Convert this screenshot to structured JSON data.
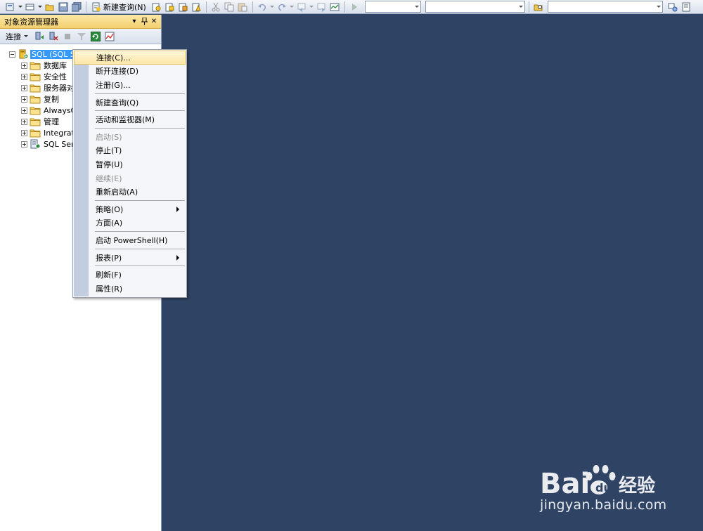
{
  "toolbar": {
    "new_query_label": "新建查询(N)"
  },
  "panel": {
    "title": "对象资源管理器",
    "pin_glyph": "▾",
    "autohide_glyph": "ᛰ",
    "close_glyph": "✕",
    "connect_label": "连接"
  },
  "tree": {
    "root": {
      "label": "SQL (SQL S",
      "icon": "server-icon"
    },
    "children": [
      {
        "label": "数据库",
        "icon": "folder-icon"
      },
      {
        "label": "安全性",
        "icon": "folder-icon"
      },
      {
        "label": "服务器对",
        "icon": "folder-icon"
      },
      {
        "label": "复制",
        "icon": "folder-icon"
      },
      {
        "label": "AlwaysO",
        "icon": "folder-icon"
      },
      {
        "label": "管理",
        "icon": "folder-icon"
      },
      {
        "label": "Integrat",
        "icon": "folder-icon"
      },
      {
        "label": "SQL Ser",
        "icon": "sql-agent-icon"
      }
    ]
  },
  "context_menu": {
    "items": [
      {
        "label": "连接(C)...",
        "state": "hover"
      },
      {
        "label": "断开连接(D)"
      },
      {
        "label": "注册(G)..."
      },
      {
        "label": "新建查询(Q)"
      },
      {
        "label": "活动和监视器(M)"
      },
      {
        "label": "启动(S)",
        "state": "disabled"
      },
      {
        "label": "停止(T)"
      },
      {
        "label": "暂停(U)"
      },
      {
        "label": "继续(E)",
        "state": "disabled"
      },
      {
        "label": "重新启动(A)"
      },
      {
        "label": "策略(O)",
        "submenu": true
      },
      {
        "label": "方面(A)"
      },
      {
        "label": "启动 PowerShell(H)"
      },
      {
        "label": "报表(P)",
        "submenu": true
      },
      {
        "label": "刷新(F)"
      },
      {
        "label": "属性(R)"
      }
    ]
  },
  "watermark": {
    "brand": "Bai",
    "brand_suffix": "经验",
    "url": "jingyan.baidu.com"
  },
  "colors": {
    "workspace": "#2f4364",
    "panel_title": "#f3cf6d",
    "selection": "#3399ff",
    "menu_hover": "#fde7a7"
  }
}
